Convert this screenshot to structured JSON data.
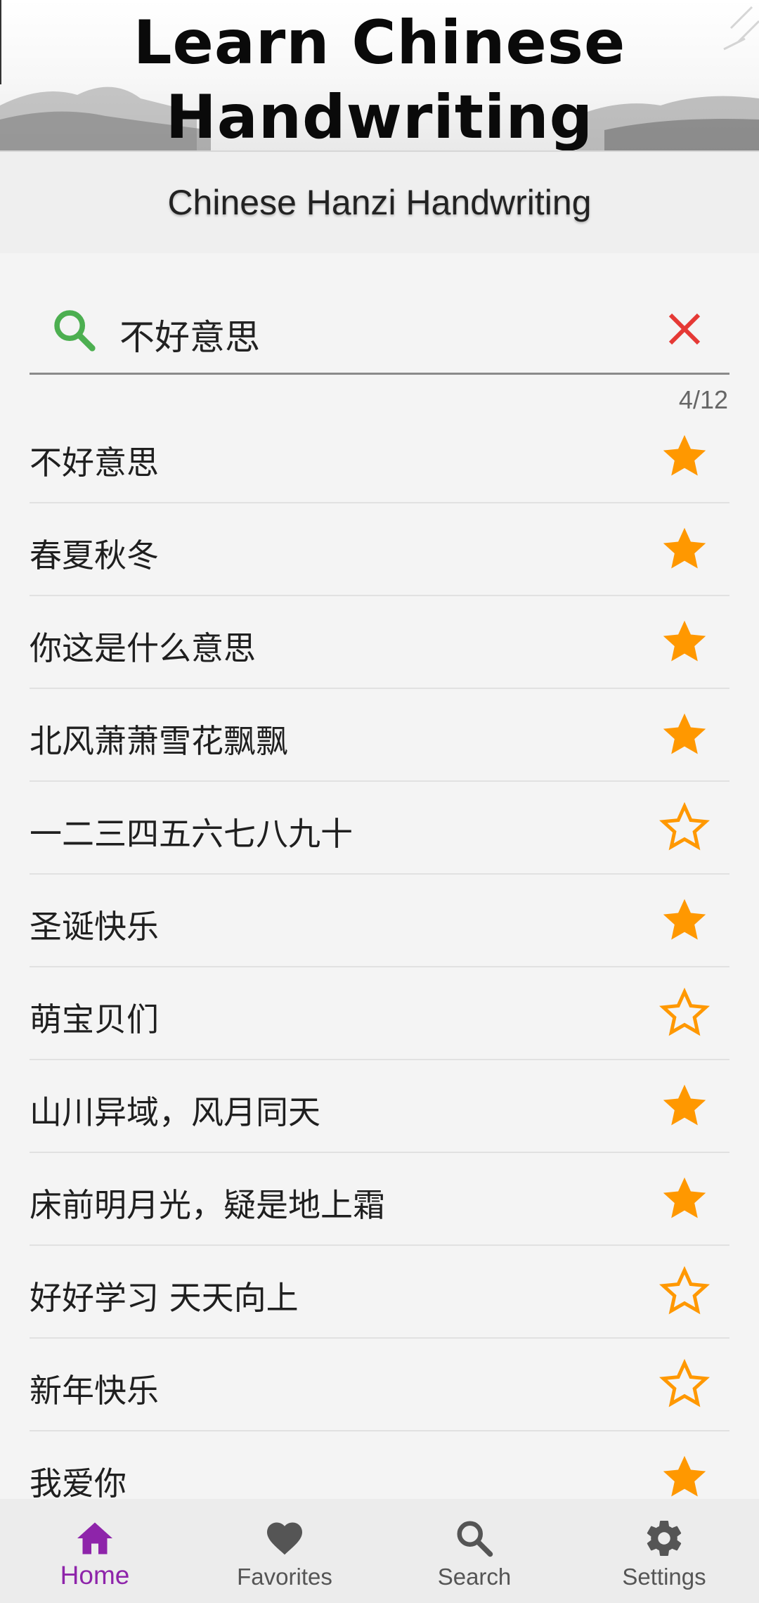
{
  "banner": {
    "title_line1": "Learn Chinese",
    "title_line2": "Handwriting"
  },
  "header": {
    "subtitle": "Chinese Hanzi Handwriting"
  },
  "search": {
    "value": "不好意思",
    "counter": "4/12"
  },
  "colors": {
    "accent": "#8e24aa",
    "star": "#ff9800",
    "search_icon": "#4caf50",
    "clear_icon": "#e53935"
  },
  "list": [
    {
      "text": "不好意思",
      "favorite": true
    },
    {
      "text": "春夏秋冬",
      "favorite": true
    },
    {
      "text": "你这是什么意思",
      "favorite": true
    },
    {
      "text": "北风萧萧雪花飘飘",
      "favorite": true
    },
    {
      "text": "一二三四五六七八九十",
      "favorite": false
    },
    {
      "text": "圣诞快乐",
      "favorite": true
    },
    {
      "text": "萌宝贝们",
      "favorite": false
    },
    {
      "text": "山川异域，风月同天",
      "favorite": true
    },
    {
      "text": "床前明月光，疑是地上霜",
      "favorite": true
    },
    {
      "text": "好好学习 天天向上",
      "favorite": false
    },
    {
      "text": "新年快乐",
      "favorite": false
    },
    {
      "text": "我爱你",
      "favorite": true
    }
  ],
  "nav": [
    {
      "label": "Home",
      "icon": "home-icon",
      "active": true
    },
    {
      "label": "Favorites",
      "icon": "heart-icon",
      "active": false
    },
    {
      "label": "Search",
      "icon": "search-icon",
      "active": false
    },
    {
      "label": "Settings",
      "icon": "gear-icon",
      "active": false
    }
  ]
}
